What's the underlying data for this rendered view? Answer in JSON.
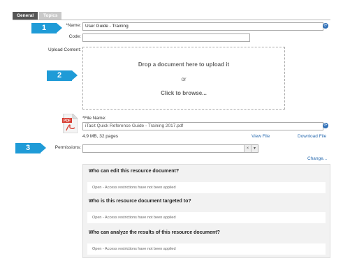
{
  "tabs": [
    {
      "label": "General",
      "active": true
    },
    {
      "label": "Topics",
      "active": false
    }
  ],
  "steps": [
    "1",
    "2",
    "3"
  ],
  "form": {
    "name_label": "*Name:",
    "name_value": "User Guide - Training",
    "code_label": "Code:",
    "code_value": "",
    "upload_label": "Upload Content:",
    "dropzone": {
      "line1": "Drop a document here to upload it",
      "line2": "or",
      "line3": "Click to browse..."
    },
    "file": {
      "label": "*File Name:",
      "value": "iTacit Quick Reference Guide - Training 2017.pdf",
      "meta": "4.9 MB, 32 pages",
      "view_link": "View File",
      "download_link": "Download File",
      "icon": "pdf-icon"
    },
    "permissions_label": "Permissions:",
    "permissions_value": "",
    "change_link": "Change..."
  },
  "permissions": [
    {
      "question": "Who can edit this resource document?",
      "answer": "Open - Access restrictions have not been applied"
    },
    {
      "question": "Who is this resource document targeted to?",
      "answer": "Open - Access restrictions have not been applied"
    },
    {
      "question": "Who can analyze the results of this resource document?",
      "answer": "Open - Access restrictions have not been applied"
    }
  ],
  "colors": {
    "badge": "#1f9bd7",
    "link": "#2b6cb0",
    "icon": "#2e6fb7"
  }
}
